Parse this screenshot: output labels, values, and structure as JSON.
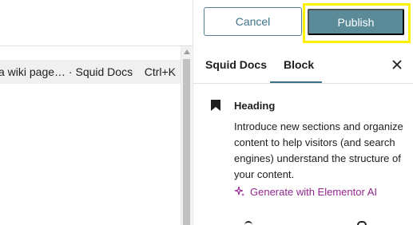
{
  "editor": {
    "search_breadcrumb": "a wiki page… · Squid Docs",
    "search_shortcut": "Ctrl+K"
  },
  "header": {
    "cancel_label": "Cancel",
    "publish_label": "Publish",
    "highlight_color": "#fff200"
  },
  "sidebar": {
    "tabs": [
      {
        "label": "Squid Docs",
        "active": false
      },
      {
        "label": "Block",
        "active": true
      }
    ],
    "close_icon": "close-icon",
    "block": {
      "icon": "bookmark-icon",
      "title": "Heading",
      "description": "Introduce new sections and organize content to help visitors (and search engines) understand the structure of your content.",
      "ai_link": "Generate with Elementor AI",
      "ai_icon": "sparkle-icon"
    }
  },
  "colors": {
    "accent": "#3c7388",
    "publish_bg": "#5b8b99",
    "ai_link": "#93278f"
  }
}
